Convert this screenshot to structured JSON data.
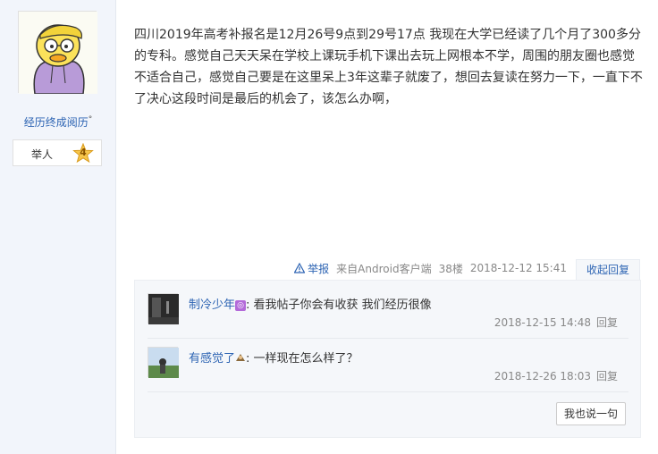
{
  "author": {
    "name": "经历终成阅历",
    "name_suffix": "°",
    "level_name": "举人",
    "level_number": "4"
  },
  "post": {
    "content": "四川2019年高考补报名是12月26号9点到29号17点 我现在大学已经读了几个月了300多分的专科。感觉自己天天呆在学校上课玩手机下课出去玩上网根本不学，周围的朋友圈也感觉不适合自己，感觉自己要是在这里呆上3年这辈子就废了，想回去复读在努力一下，一直下不了决心这段时间是最后的机会了，该怎么办啊，",
    "report_label": "举报",
    "source": "来自Android客户端",
    "floor": "38楼",
    "time": "2018-12-12 15:41",
    "collapse_reply_label": "收起回复"
  },
  "replies": [
    {
      "user": "制冷少年",
      "separator": ":",
      "text": "看我帖子你会有收获 我们经历很像",
      "time": "2018-12-15 14:48",
      "reply_label": "回复"
    },
    {
      "user": "有感觉了",
      "separator": ":",
      "text": "一样现在怎么样了？",
      "time": "2018-12-26 18:03",
      "reply_label": "回复"
    }
  ],
  "say_button_label": "我也说一句",
  "colors": {
    "link": "#2d64b3",
    "sidebar_bg": "#f2f5fb",
    "reply_bg": "#f5f7fa"
  }
}
